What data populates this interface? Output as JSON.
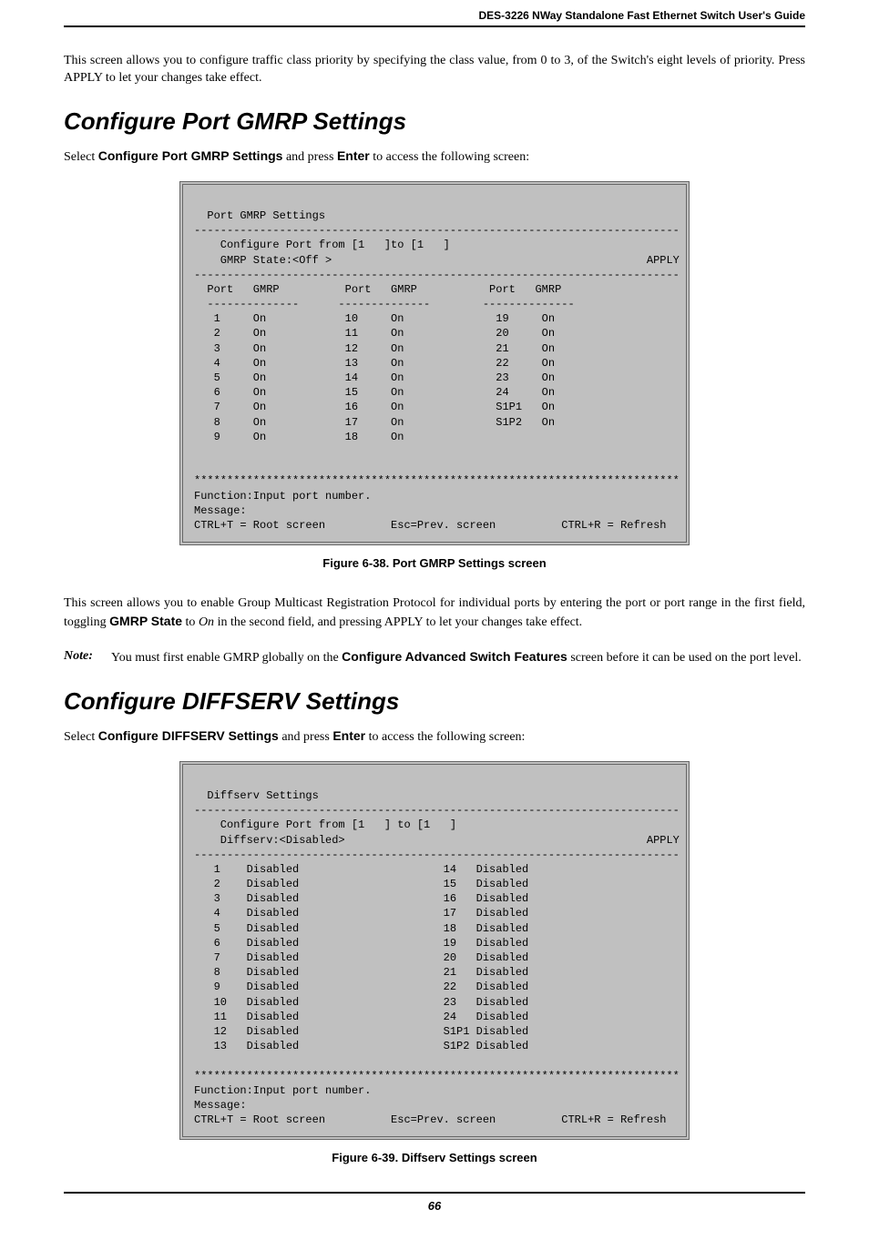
{
  "header_title": "DES-3226 NWay Standalone Fast Ethernet Switch User's Guide",
  "intro_para": "This screen allows you to configure traffic class priority by specifying the class value, from 0 to 3, of the Switch's eight levels of priority. Press APPLY to let your changes take effect.",
  "section1": {
    "heading": "Configure Port GMRP Settings",
    "select_prefix": "Select ",
    "select_bold": "Configure Port GMRP Settings",
    "select_mid": " and press ",
    "select_enter": "Enter",
    "select_suffix": " to access the following screen:",
    "terminal": "\n  Port GMRP Settings\n--------------------------------------------------------------------------\n    Configure Port from [1   ]to [1   ]\n    GMRP State:<Off >                                                APPLY\n--------------------------------------------------------------------------\n  Port   GMRP          Port   GMRP           Port   GMRP\n  --------------      --------------        --------------\n   1     On            10     On              19     On\n   2     On            11     On              20     On\n   3     On            12     On              21     On\n   4     On            13     On              22     On\n   5     On            14     On              23     On\n   6     On            15     On              24     On\n   7     On            16     On              S1P1   On\n   8     On            17     On              S1P2   On\n   9     On            18     On\n\n\n**************************************************************************\nFunction:Input port number.\nMessage:\nCTRL+T = Root screen          Esc=Prev. screen          CTRL+R = Refresh",
    "caption": "Figure 6-38.  Port GMRP Settings screen",
    "after_para_1": "This screen allows you to enable Group Multicast Registration Protocol for individual ports by entering the port or port range in the first field, toggling ",
    "gmrp_state": "GMRP State",
    "after_para_2": " to ",
    "on_italic": "On",
    "after_para_3": " in the second field, and pressing APPLY to let your changes take effect.",
    "note_label": "Note:",
    "note_1": "You must first enable GMRP globally on the ",
    "note_bold": "Configure Advanced Switch Features",
    "note_2": " screen before it can be used on the port level."
  },
  "section2": {
    "heading": "Configure DIFFSERV Settings",
    "select_prefix": "Select ",
    "select_bold": "Configure DIFFSERV Settings",
    "select_mid": " and press ",
    "select_enter": "Enter",
    "select_suffix": " to access the following screen:",
    "terminal": "\n  Diffserv Settings\n--------------------------------------------------------------------------\n    Configure Port from [1   ] to [1   ]\n    Diffserv:<Disabled>                                              APPLY\n--------------------------------------------------------------------------\n   1    Disabled                      14   Disabled\n   2    Disabled                      15   Disabled\n   3    Disabled                      16   Disabled\n   4    Disabled                      17   Disabled\n   5    Disabled                      18   Disabled\n   6    Disabled                      19   Disabled\n   7    Disabled                      20   Disabled\n   8    Disabled                      21   Disabled\n   9    Disabled                      22   Disabled\n   10   Disabled                      23   Disabled\n   11   Disabled                      24   Disabled\n   12   Disabled                      S1P1 Disabled\n   13   Disabled                      S1P2 Disabled\n\n**************************************************************************\nFunction:Input port number.\nMessage:\nCTRL+T = Root screen          Esc=Prev. screen          CTRL+R = Refresh",
    "caption": "Figure 6-39.  Diffserv Settings screen"
  },
  "page_number": "66"
}
